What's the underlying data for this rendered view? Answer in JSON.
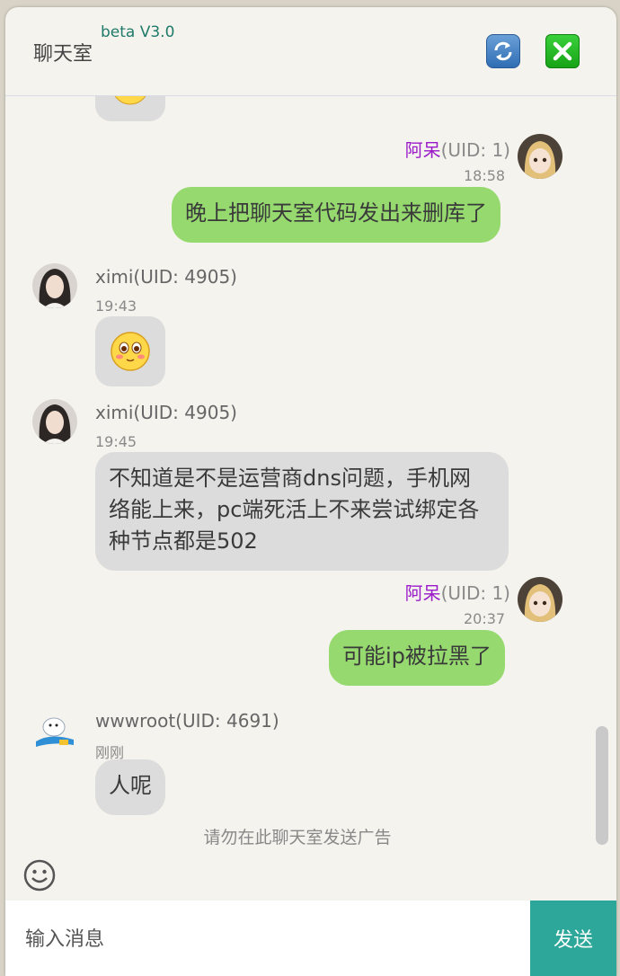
{
  "header": {
    "title": "聊天室",
    "version": "beta V3.0",
    "refresh_icon": "refresh-icon",
    "close_icon": "close-icon"
  },
  "messages": [
    {
      "sender": "阿呆",
      "uid": "(UID: 1)",
      "time": "18:58",
      "text": "晚上把聊天室代码发出来删库了",
      "mine": true
    },
    {
      "sender": "ximi(UID: 4905)",
      "time": "19:43",
      "emoji": "blush-emoji",
      "mine": false
    },
    {
      "sender": "ximi(UID: 4905)",
      "time": "19:45",
      "text_lines": [
        "不知道是不是运营商dns问题，手机网",
        "络能上来，pc端死活上不来尝试绑定各",
        "种节点都是502"
      ],
      "mine": false
    },
    {
      "sender": "阿呆",
      "uid": "(UID: 1)",
      "time": "20:37",
      "text": "可能ip被拉黑了",
      "mine": true
    },
    {
      "sender": "wwwroot(UID: 4691)",
      "time": "刚刚",
      "text": "人呢",
      "mine": false
    }
  ],
  "notice": "请勿在此聊天室发送广告",
  "composer": {
    "emoji_icon": "smiley-icon",
    "placeholder": "输入消息",
    "send_label": "发送"
  },
  "colors": {
    "mine_bubble": "#95d96f",
    "other_bubble": "#dcdcdc",
    "send_button": "#2ea79b",
    "owner_name": "#9a19c9"
  }
}
